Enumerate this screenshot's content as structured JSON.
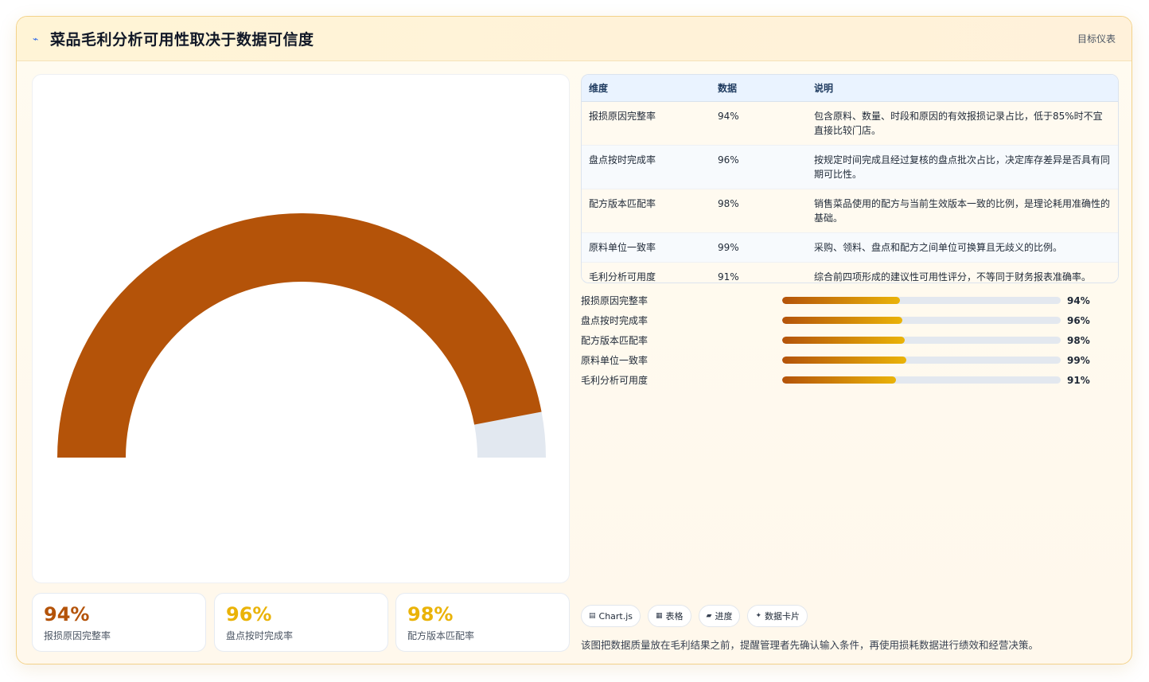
{
  "header": {
    "icon": "line-chart-icon",
    "title": "菜品毛利分析可用性取决于数据可信度",
    "right_label": "目标仪表"
  },
  "colors": {
    "gauge_fill": "#b45309",
    "gauge_track": "#e2e8f0",
    "kpi_colors": [
      "#b45309",
      "#eab308",
      "#eab308"
    ],
    "bar_gradient_start": "#b45309",
    "bar_gradient_end": "#eab308"
  },
  "chart_data": {
    "type": "gauge",
    "value": 94,
    "max": 100,
    "unit": "%"
  },
  "kpis": [
    {
      "value": "94%",
      "label": "报损原因完整率"
    },
    {
      "value": "96%",
      "label": "盘点按时完成率"
    },
    {
      "value": "98%",
      "label": "配方版本匹配率"
    }
  ],
  "table": {
    "headers": [
      "维度",
      "数据",
      "说明"
    ],
    "rows": [
      {
        "dim": "报损原因完整率",
        "value": "94%",
        "desc": "包含原料、数量、时段和原因的有效报损记录占比，低于85%时不宜直接比较门店。"
      },
      {
        "dim": "盘点按时完成率",
        "value": "96%",
        "desc": "按规定时间完成且经过复核的盘点批次占比，决定库存差异是否具有同期可比性。"
      },
      {
        "dim": "配方版本匹配率",
        "value": "98%",
        "desc": "销售菜品使用的配方与当前生效版本一致的比例，是理论耗用准确性的基础。"
      },
      {
        "dim": "原料单位一致率",
        "value": "99%",
        "desc": "采购、领料、盘点和配方之间单位可换算且无歧义的比例。"
      },
      {
        "dim": "毛利分析可用度",
        "value": "91%",
        "desc": "综合前四项形成的建议性可用性评分，不等同于财务报表准确率。"
      }
    ]
  },
  "progress": [
    {
      "label": "报损原因完整率",
      "value": "94%",
      "fraction": 0.94
    },
    {
      "label": "盘点按时完成率",
      "value": "96%",
      "fraction": 0.96
    },
    {
      "label": "配方版本匹配率",
      "value": "98%",
      "fraction": 0.98
    },
    {
      "label": "原料单位一致率",
      "value": "99%",
      "fraction": 0.99
    },
    {
      "label": "毛利分析可用度",
      "value": "91%",
      "fraction": 0.91
    }
  ],
  "chips": [
    {
      "icon": "chart-icon",
      "glyph": "▤",
      "label": "Chart.js"
    },
    {
      "icon": "table-icon",
      "glyph": "▦",
      "label": "表格"
    },
    {
      "icon": "progress-icon",
      "glyph": "▰",
      "label": "进度"
    },
    {
      "icon": "sparkle-icon",
      "glyph": "✦",
      "label": "数据卡片"
    }
  ],
  "footnote": "该图把数据质量放在毛利结果之前，提醒管理者先确认输入条件，再使用损耗数据进行绩效和经营决策。"
}
